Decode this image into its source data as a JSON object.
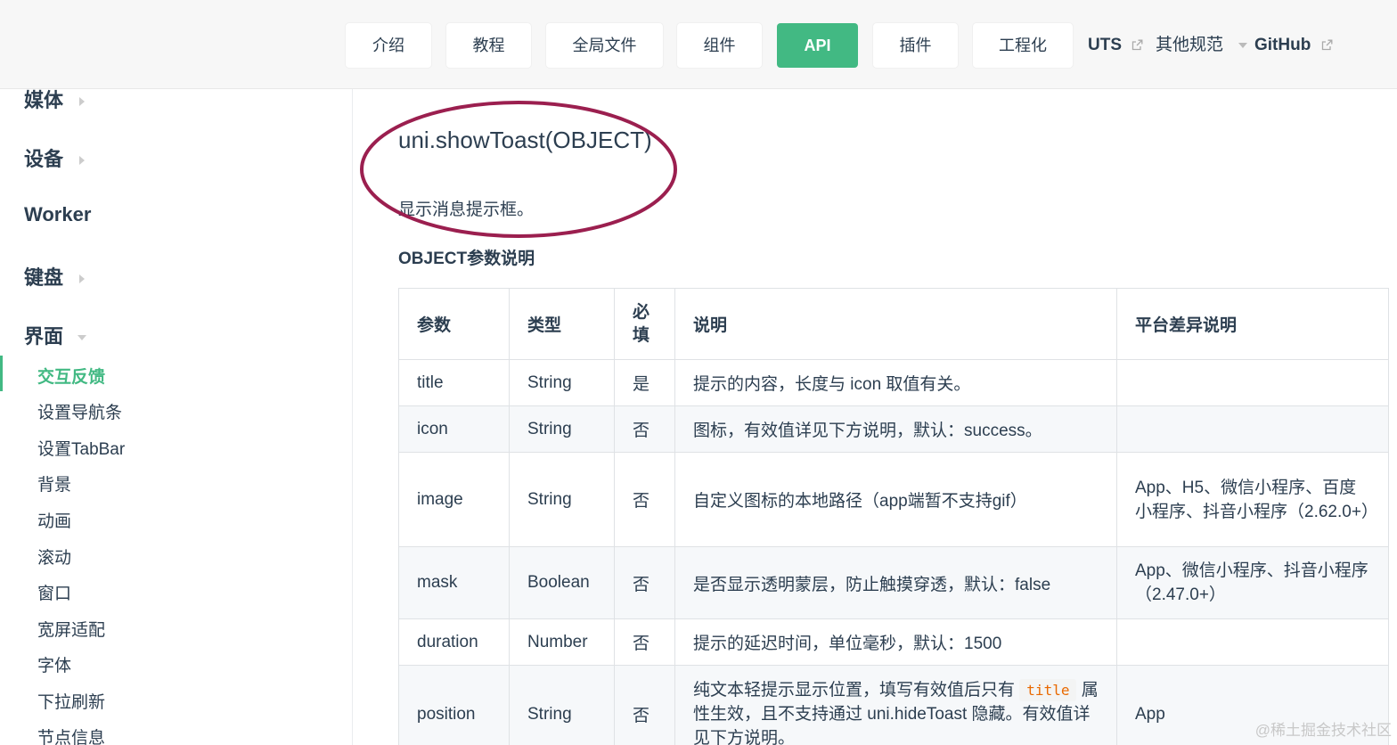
{
  "nav": {
    "buttons": [
      {
        "label": "介绍"
      },
      {
        "label": "教程"
      },
      {
        "label": "全局文件"
      },
      {
        "label": "组件"
      },
      {
        "label": "API"
      },
      {
        "label": "插件"
      },
      {
        "label": "工程化"
      }
    ],
    "uts_label": "UTS",
    "other_label": "其他规范",
    "github_label": "GitHub",
    "active_color": "#42b983"
  },
  "sidebar": {
    "groups": [
      {
        "label": "媒体"
      },
      {
        "label": "设备"
      },
      {
        "label": "Worker"
      },
      {
        "label": "键盘"
      },
      {
        "label": "界面"
      }
    ],
    "items": [
      {
        "label": "交互反馈"
      },
      {
        "label": "设置导航条"
      },
      {
        "label": "设置TabBar"
      },
      {
        "label": "背景"
      },
      {
        "label": "动画"
      },
      {
        "label": "滚动"
      },
      {
        "label": "窗口"
      },
      {
        "label": "宽屏适配"
      },
      {
        "label": "字体"
      },
      {
        "label": "下拉刷新"
      },
      {
        "label": "节点信息"
      }
    ]
  },
  "main": {
    "title": "uni.showToast(OBJECT)",
    "description": "显示消息提示框。",
    "section_title": "OBJECT参数说明",
    "highlight_color": "#9b1f4f",
    "table": {
      "headers": {
        "param": "参数",
        "type": "类型",
        "required": "必填",
        "desc": "说明",
        "platform": "平台差异说明"
      },
      "rows": [
        {
          "param": "title",
          "type": "String",
          "required": "是",
          "desc": "提示的内容，长度与 icon 取值有关。",
          "platform": ""
        },
        {
          "param": "icon",
          "type": "String",
          "required": "否",
          "desc": "图标，有效值详见下方说明，默认：success。",
          "platform": ""
        },
        {
          "param": "image",
          "type": "String",
          "required": "否",
          "desc": "自定义图标的本地路径（app端暂不支持gif）",
          "platform": "App、H5、微信小程序、百度小程序、抖音小程序（2.62.0+）"
        },
        {
          "param": "mask",
          "type": "Boolean",
          "required": "否",
          "desc": "是否显示透明蒙层，防止触摸穿透，默认：false",
          "platform": "App、微信小程序、抖音小程序（2.47.0+）"
        },
        {
          "param": "duration",
          "type": "Number",
          "required": "否",
          "desc": "提示的延迟时间，单位毫秒，默认：1500",
          "platform": ""
        },
        {
          "param": "position",
          "type": "String",
          "required": "否",
          "desc_before": "纯文本轻提示显示位置，填写有效值后只有",
          "desc_code": "title",
          "desc_after": "属性生效，且不支持通过 uni.hideToast 隐藏。有效值详见下方说明。",
          "platform": "App"
        }
      ]
    }
  },
  "watermark": "@稀土掘金技术社区"
}
